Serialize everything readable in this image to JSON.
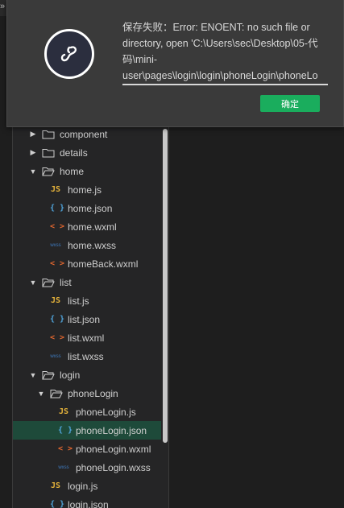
{
  "dialog": {
    "message_lines": [
      "保存失败：Error: ENOENT: no such file or",
      "directory, open 'C:\\Users\\sec\\Desktop\\05-代",
      "码\\mini-",
      "user\\pages\\login\\login\\phoneLogin\\phoneLo"
    ],
    "ok_label": "确定"
  },
  "top_edge_glyph": "»",
  "tree": {
    "items": [
      {
        "label": "component",
        "kind": "folder",
        "state": "collapsed"
      },
      {
        "label": "details",
        "kind": "folder",
        "state": "collapsed"
      },
      {
        "label": "home",
        "kind": "folder",
        "state": "expanded"
      },
      {
        "label": "home.js",
        "kind": "js",
        "icon": "JS"
      },
      {
        "label": "home.json",
        "kind": "json",
        "icon": "{ }"
      },
      {
        "label": "home.wxml",
        "kind": "wxml",
        "icon": "< >"
      },
      {
        "label": "home.wxss",
        "kind": "wxss",
        "icon": "wxss"
      },
      {
        "label": "homeBack.wxml",
        "kind": "wxml",
        "icon": "< >"
      },
      {
        "label": "list",
        "kind": "folder",
        "state": "expanded"
      },
      {
        "label": "list.js",
        "kind": "js",
        "icon": "JS"
      },
      {
        "label": "list.json",
        "kind": "json",
        "icon": "{ }"
      },
      {
        "label": "list.wxml",
        "kind": "wxml",
        "icon": "< >"
      },
      {
        "label": "list.wxss",
        "kind": "wxss",
        "icon": "wxss"
      },
      {
        "label": "login",
        "kind": "folder",
        "state": "expanded"
      },
      {
        "label": "phoneLogin",
        "kind": "folder",
        "state": "expanded"
      },
      {
        "label": "phoneLogin.js",
        "kind": "js",
        "icon": "JS"
      },
      {
        "label": "phoneLogin.json",
        "kind": "json",
        "icon": "{ }",
        "selected": true
      },
      {
        "label": "phoneLogin.wxml",
        "kind": "wxml",
        "icon": "< >"
      },
      {
        "label": "phoneLogin.wxss",
        "kind": "wxss",
        "icon": "wxss"
      },
      {
        "label": "login.js",
        "kind": "js",
        "icon": "JS"
      },
      {
        "label": "login.json",
        "kind": "json",
        "icon": "{ }"
      }
    ]
  },
  "colors": {
    "accent_button": "#1aad5d",
    "selected_row": "#1e4a3a",
    "js_icon": "#e5b33b",
    "json_icon": "#4fa3d9",
    "wxml_icon": "#e3672f",
    "wxss_icon": "#3f7bbf"
  }
}
